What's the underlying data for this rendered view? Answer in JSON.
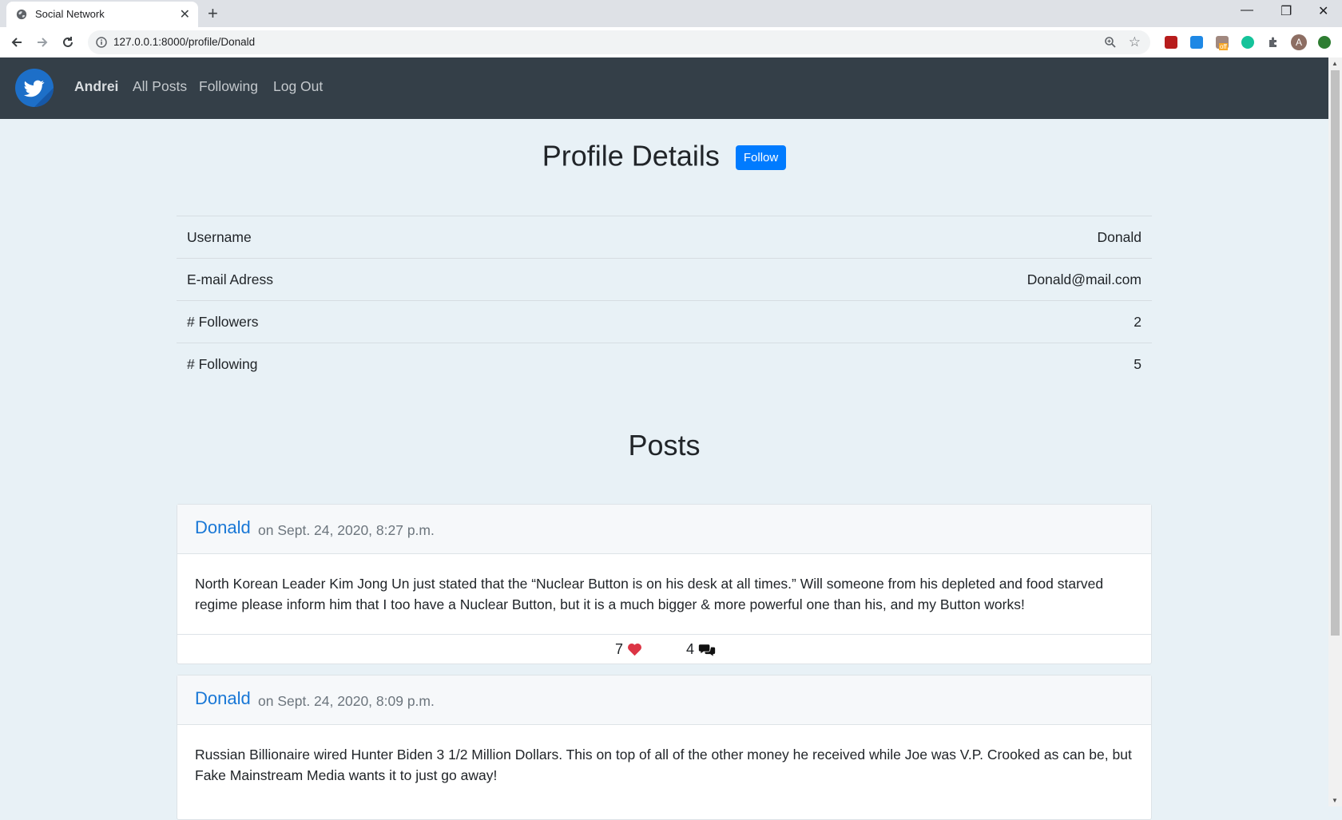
{
  "browser": {
    "tab_title": "Social Network",
    "url": "127.0.0.1:8000/profile/Donald",
    "extension_badge": "off",
    "profile_initial": "A"
  },
  "navbar": {
    "username": "Andrei",
    "links": [
      "All Posts",
      "Following",
      "Log Out"
    ]
  },
  "profile": {
    "title": "Profile Details",
    "follow_label": "Follow",
    "rows": [
      {
        "label": "Username",
        "value": "Donald"
      },
      {
        "label": "E-mail Adress",
        "value": "Donald@mail.com"
      },
      {
        "label": "# Followers",
        "value": "2"
      },
      {
        "label": "# Following",
        "value": "5"
      }
    ]
  },
  "posts_title": "Posts",
  "posts": [
    {
      "author": "Donald",
      "date": "on Sept. 24, 2020, 8:27 p.m.",
      "content": "North Korean Leader Kim Jong Un just stated that the “Nuclear Button is on his desk at all times.” Will someone from his depleted and food starved regime please inform him that I too have a Nuclear Button, but it is a much bigger & more powerful one than his, and my Button works!",
      "likes": "7",
      "comments": "4"
    },
    {
      "author": "Donald",
      "date": "on Sept. 24, 2020, 8:09 p.m.",
      "content": "Russian Billionaire wired Hunter Biden 3 1/2 Million Dollars. This on top of all of the other money he received while Joe was V.P. Crooked as can be, but Fake Mainstream Media wants it to just go away!"
    }
  ],
  "colors": {
    "navbar": "#343f48",
    "link": "#1877d6",
    "button": "#007bff",
    "heart": "#dc3545"
  }
}
